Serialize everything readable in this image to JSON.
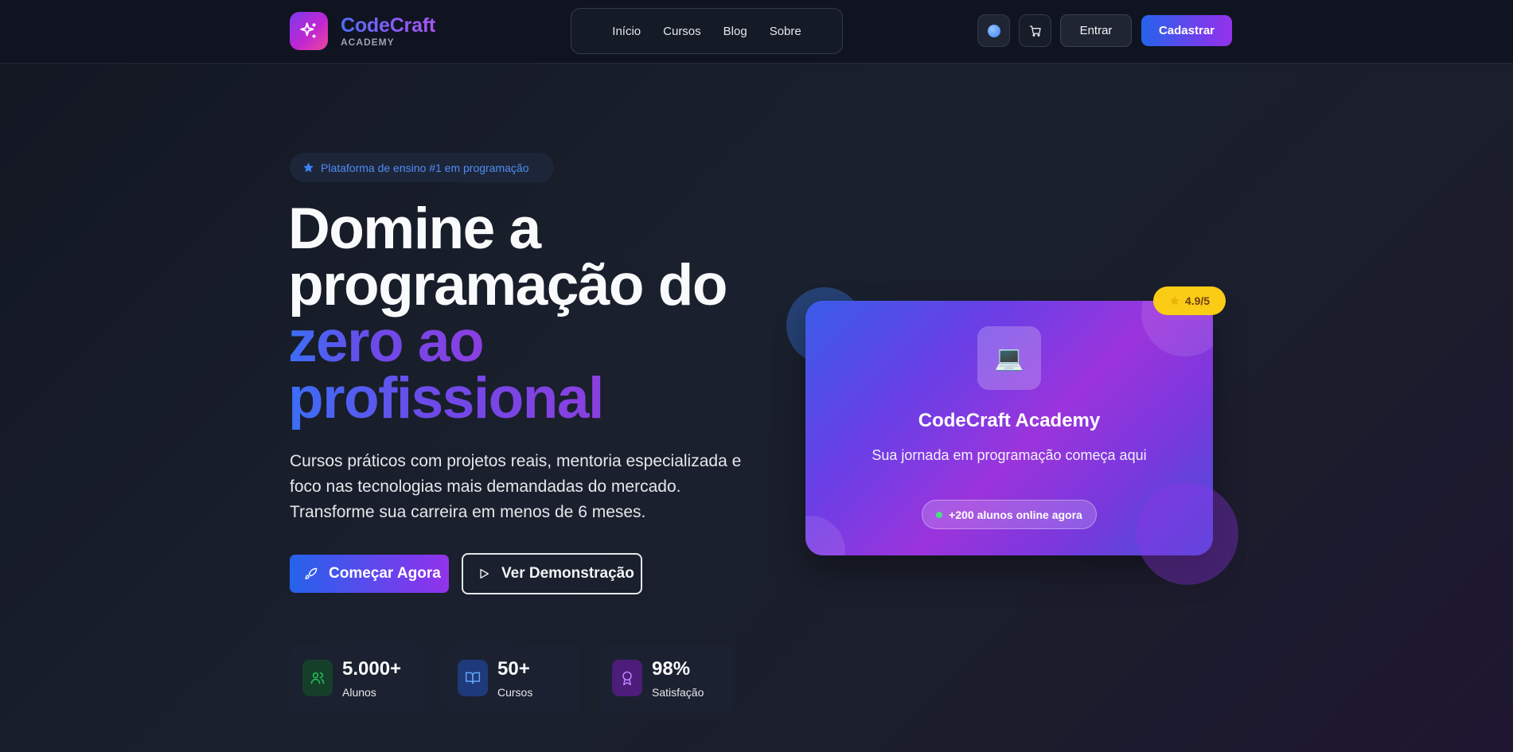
{
  "header": {
    "brand_name": "CodeCraft",
    "brand_sub": "ACADEMY",
    "nav": [
      "Início",
      "Cursos",
      "Blog",
      "Sobre"
    ],
    "login_label": "Entrar",
    "signup_label": "Cadastrar"
  },
  "hero": {
    "badge": "Plataforma de ensino #1 em programação",
    "headline_line1": "Domine a",
    "headline_line2": "programação do",
    "headline_line3": "zero ao",
    "headline_line4": "profissional",
    "lead": "Cursos práticos com projetos reais, mentoria especializada e foco nas tecnologias mais demandadas do mercado. Transforme sua carreira em menos de 6 meses.",
    "cta_primary": "Começar Agora",
    "cta_secondary": "Ver Demonstração"
  },
  "stats": [
    {
      "value": "5.000+",
      "label": "Alunos",
      "icon": "users-icon",
      "color": "#22c55e"
    },
    {
      "value": "50+",
      "label": "Cursos",
      "icon": "book-icon",
      "color": "#60a5fa"
    },
    {
      "value": "98%",
      "label": "Satisfação",
      "icon": "award-icon",
      "color": "#c084fc"
    }
  ],
  "card": {
    "icon": "💻",
    "title": "CodeCraft Academy",
    "subtitle": "Sua jornada em programação começa aqui",
    "online": "+200 alunos online agora",
    "rating": "4.9/5"
  },
  "colors": {
    "accent_blue": "#2563eb",
    "accent_purple": "#7c3aed",
    "rating_yellow": "#facc15"
  }
}
